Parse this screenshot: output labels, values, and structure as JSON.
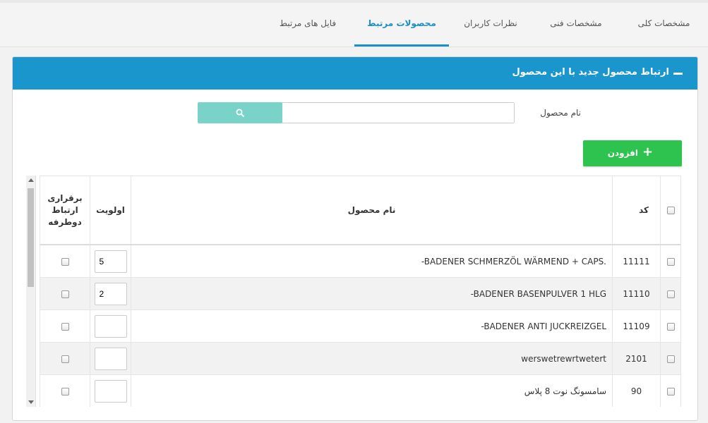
{
  "tabs": [
    {
      "label": "مشخصات کلی",
      "active": false
    },
    {
      "label": "مشخصات فنی",
      "active": false
    },
    {
      "label": "نظرات کاربران",
      "active": false
    },
    {
      "label": "محصولات مرتبط",
      "active": true
    },
    {
      "label": "فایل های مرتبط",
      "active": false
    }
  ],
  "panel": {
    "title": "ارتباط محصول جدید با این محصول",
    "header_color": "#1a96cc"
  },
  "search": {
    "label": "نام محصول",
    "value": "",
    "placeholder": "",
    "button_icon": "search-icon"
  },
  "add_button": {
    "label": "افزودن",
    "icon": "plus-icon",
    "color": "#2ec24e"
  },
  "table": {
    "headers": {
      "code": "کد",
      "name": "نام محصول",
      "priority": "اولویت",
      "bidirectional_line1": "برقراری",
      "bidirectional_line2": "ارتباط",
      "bidirectional_line3": "دوطرفه"
    },
    "rows": [
      {
        "code": "11111",
        "name": "-BADENER SCHMERZÖL WÄRMEND + CAPS.",
        "priority": "5"
      },
      {
        "code": "11110",
        "name": "-BADENER BASENPULVER 1 HLG",
        "priority": "2"
      },
      {
        "code": "11109",
        "name": "-BADENER ANTI JUCKREIZGEL",
        "priority": ""
      },
      {
        "code": "2101",
        "name": "werswetrewrtwetert",
        "priority": ""
      },
      {
        "code": "90",
        "name": "سامسونگ نوت 8 پلاس",
        "priority": ""
      }
    ]
  }
}
